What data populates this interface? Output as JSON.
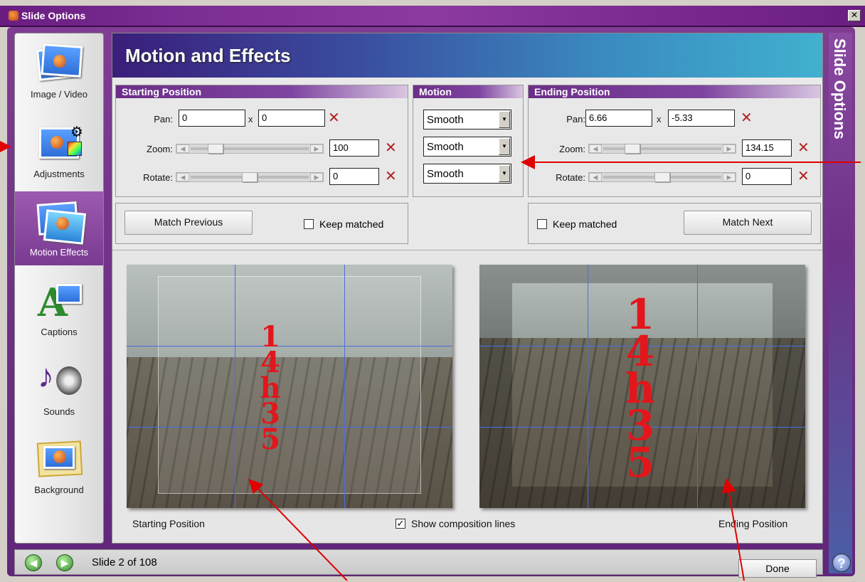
{
  "window": {
    "title": "Slide Options",
    "close_glyph": "✕"
  },
  "sidebar": {
    "items": [
      {
        "label": "Image / Video",
        "icon": "images-icon"
      },
      {
        "label": "Adjustments",
        "icon": "adjustments-icon"
      },
      {
        "label": "Motion Effects",
        "icon": "motion-effects-icon",
        "active": true
      },
      {
        "label": "Captions",
        "icon": "captions-icon"
      },
      {
        "label": "Sounds",
        "icon": "sounds-icon"
      },
      {
        "label": "Background",
        "icon": "background-icon"
      }
    ]
  },
  "header": {
    "title": "Motion and Effects"
  },
  "starting": {
    "title": "Starting Position",
    "pan_label": "Pan:",
    "pan_x": "0",
    "pan_y": "0",
    "x_sep": "x",
    "zoom_label": "Zoom:",
    "zoom_value": "100",
    "rotate_label": "Rotate:",
    "rotate_value": "0",
    "match_button": "Match Previous",
    "keep_matched": "Keep matched"
  },
  "motion": {
    "title": "Motion",
    "options": [
      "Smooth",
      "Smooth",
      "Smooth"
    ]
  },
  "ending": {
    "title": "Ending Position",
    "pan_label": "Pan:",
    "pan_x": "6.66",
    "pan_y": "-5.33",
    "x_sep": "x",
    "zoom_label": "Zoom:",
    "zoom_value": "134.15",
    "rotate_label": "Rotate:",
    "rotate_value": "0",
    "match_button": "Match Next",
    "keep_matched": "Keep matched"
  },
  "preview": {
    "start_label": "Starting Position",
    "end_label": "Ending Position",
    "show_lines_label": "Show composition lines",
    "show_lines_checked": true,
    "overlay_text": "14h35"
  },
  "sidebar_right": {
    "label": "Slide Options",
    "help": "?"
  },
  "footer": {
    "slide_count": "Slide 2 of 108",
    "done": "Done"
  },
  "colors": {
    "accent": "#6c2e88",
    "header_end": "#41b0cf",
    "clear_x": "#b02020",
    "annotation_arrow": "#e00000"
  }
}
